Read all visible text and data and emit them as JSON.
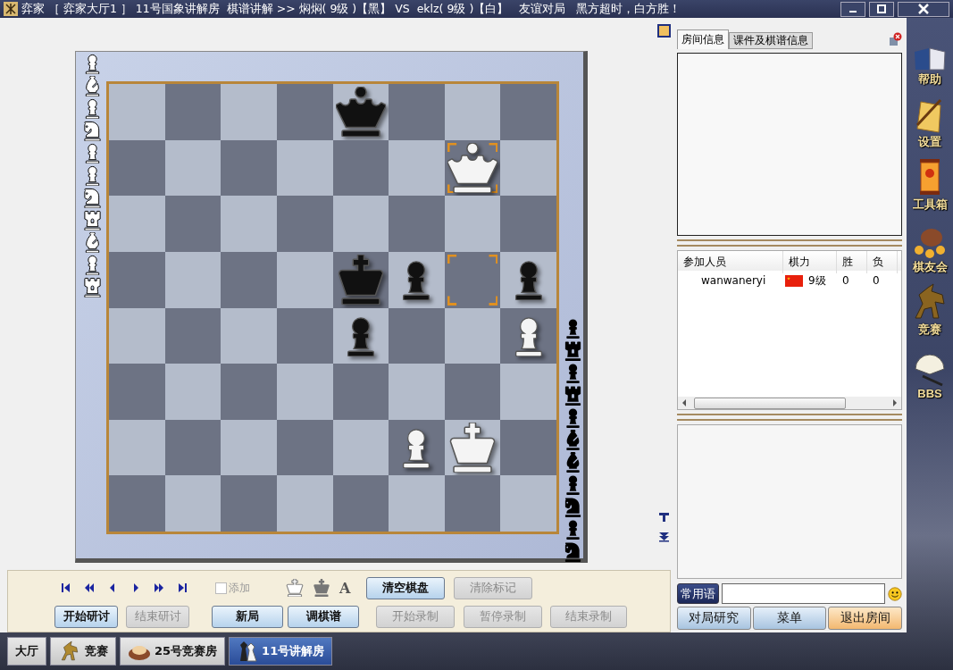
{
  "window": {
    "title": "弈家 ［ 弈家大厅1 ］ 11号国象讲解房  棋谱讲解 >> 焖焖( 9级 )【黑】 VS  eklz( 9级 )【白】   友谊对局   黑方超时，白方胜！"
  },
  "board": {
    "ranks": [
      [
        {
          "highlighted": false
        },
        {
          "highlighted": false
        },
        {
          "highlighted": false
        },
        {
          "highlighted": false
        },
        {
          "highlighted": false,
          "kind": "queen",
          "color": "#111111"
        },
        {
          "highlighted": false
        },
        {
          "highlighted": false
        },
        {
          "highlighted": false
        }
      ],
      [
        {
          "highlighted": false
        },
        {
          "highlighted": false
        },
        {
          "highlighted": false
        },
        {
          "highlighted": false
        },
        {
          "highlighted": false
        },
        {
          "highlighted": false
        },
        {
          "highlighted": true,
          "kind": "queen",
          "color": "#f4f4f4"
        },
        {
          "highlighted": false
        }
      ],
      [
        {
          "highlighted": false
        },
        {
          "highlighted": false
        },
        {
          "highlighted": false
        },
        {
          "highlighted": false
        },
        {
          "highlighted": false
        },
        {
          "highlighted": false
        },
        {
          "highlighted": false
        },
        {
          "highlighted": false
        }
      ],
      [
        {
          "highlighted": false
        },
        {
          "highlighted": false
        },
        {
          "highlighted": false
        },
        {
          "highlighted": false
        },
        {
          "highlighted": false,
          "kind": "king",
          "color": "#111111"
        },
        {
          "highlighted": false,
          "kind": "pawn",
          "color": "#111111"
        },
        {
          "highlighted": true
        },
        {
          "highlighted": false,
          "kind": "pawn",
          "color": "#111111"
        }
      ],
      [
        {
          "highlighted": false
        },
        {
          "highlighted": false
        },
        {
          "highlighted": false
        },
        {
          "highlighted": false
        },
        {
          "highlighted": false,
          "kind": "pawn",
          "color": "#111111"
        },
        {
          "highlighted": false
        },
        {
          "highlighted": false
        },
        {
          "highlighted": false,
          "kind": "pawn",
          "color": "#f4f4f4"
        }
      ],
      [
        {
          "highlighted": false
        },
        {
          "highlighted": false
        },
        {
          "highlighted": false
        },
        {
          "highlighted": false
        },
        {
          "highlighted": false
        },
        {
          "highlighted": false
        },
        {
          "highlighted": false
        },
        {
          "highlighted": false
        }
      ],
      [
        {
          "highlighted": false
        },
        {
          "highlighted": false
        },
        {
          "highlighted": false
        },
        {
          "highlighted": false
        },
        {
          "highlighted": false
        },
        {
          "highlighted": false,
          "kind": "pawn",
          "color": "#f4f4f4"
        },
        {
          "highlighted": false,
          "kind": "king",
          "color": "#f4f4f4"
        },
        {
          "highlighted": false
        }
      ],
      [
        {
          "highlighted": false
        },
        {
          "highlighted": false
        },
        {
          "highlighted": false
        },
        {
          "highlighted": false
        },
        {
          "highlighted": false
        },
        {
          "highlighted": false
        },
        {
          "highlighted": false
        },
        {
          "highlighted": false
        }
      ]
    ],
    "captured_white": [
      {
        "kind": "pawn"
      },
      {
        "kind": "bishop"
      },
      {
        "kind": "pawn"
      },
      {
        "kind": "knight"
      },
      {
        "kind": "pawn"
      },
      {
        "kind": "pawn"
      },
      {
        "kind": "knight"
      },
      {
        "kind": "rook"
      },
      {
        "kind": "bishop"
      },
      {
        "kind": "pawn"
      },
      {
        "kind": "rook"
      }
    ],
    "captured_black": [
      {
        "kind": "pawn"
      },
      {
        "kind": "rook"
      },
      {
        "kind": "pawn"
      },
      {
        "kind": "rook"
      },
      {
        "kind": "pawn"
      },
      {
        "kind": "bishop"
      },
      {
        "kind": "bishop"
      },
      {
        "kind": "pawn"
      },
      {
        "kind": "knight"
      },
      {
        "kind": "pawn"
      },
      {
        "kind": "knight"
      }
    ]
  },
  "controls": {
    "add_checkbox": {
      "label": "添加",
      "checked": false,
      "disabled": true
    },
    "font_icon": "A",
    "row1_buttons": [
      {
        "label": "清空棋盘",
        "disabled": false
      },
      {
        "label": "清除标记",
        "disabled": true
      }
    ],
    "row2_buttons": [
      {
        "label": "开始研讨",
        "disabled": false
      },
      {
        "label": "结束研讨",
        "disabled": true
      },
      {
        "label": "新局",
        "disabled": false
      },
      {
        "label": "调棋谱",
        "disabled": false
      },
      {
        "label": "开始录制",
        "disabled": true
      },
      {
        "label": "暂停录制",
        "disabled": true
      },
      {
        "label": "结束录制",
        "disabled": true
      }
    ]
  },
  "right_panel": {
    "tabs": [
      {
        "label": "房间信息",
        "selected": true
      },
      {
        "label": "课件及棋谱信息",
        "selected": false
      }
    ],
    "players": {
      "columns": [
        "参加人员",
        "棋力",
        "胜",
        "负"
      ],
      "rows": [
        {
          "name": "wanwaneryi",
          "rating": "9级",
          "wins": "0",
          "losses": "0"
        }
      ]
    },
    "phrase_button": "常用语",
    "buttons": [
      {
        "label": "对局研究",
        "kind": "normal"
      },
      {
        "label": "菜单",
        "kind": "normal"
      },
      {
        "label": "退出房间",
        "kind": "exit"
      }
    ]
  },
  "sidebar": {
    "items": [
      {
        "label": "帮助",
        "kind": "help"
      },
      {
        "label": "设置",
        "kind": "settings"
      },
      {
        "label": "工具箱",
        "kind": "toolbox"
      },
      {
        "label": "棋友会",
        "kind": "club"
      },
      {
        "label": "竞赛",
        "kind": "contest"
      },
      {
        "label": "BBS",
        "kind": "bbs"
      }
    ]
  },
  "taskbar": {
    "tabs": [
      {
        "label": "大厅",
        "kind": "plain",
        "selected": false
      },
      {
        "label": "竞赛",
        "kind": "contest",
        "selected": false
      },
      {
        "label": "25号竞赛房",
        "kind": "room",
        "selected": false
      },
      {
        "label": "11号讲解房",
        "kind": "lecture",
        "selected": true
      }
    ]
  }
}
